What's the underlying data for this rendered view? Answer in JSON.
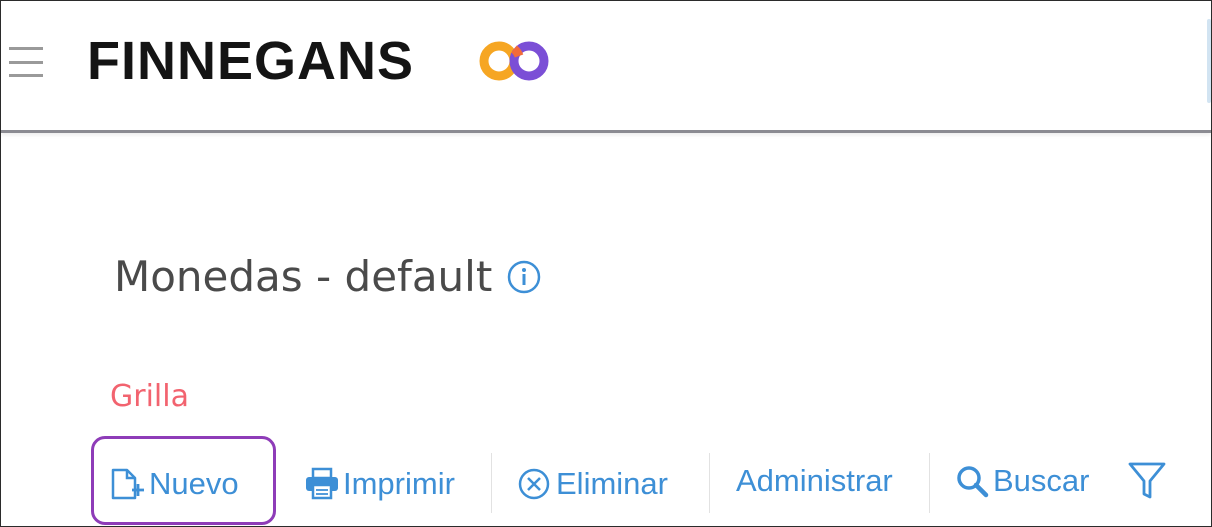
{
  "header": {
    "brand_name": "FINNEGANS",
    "menu_icon": "hamburger-menu-icon",
    "logo_icon": "infinity-logo-icon",
    "logo_colors": [
      "#f6a623",
      "#7b4fd6",
      "#f26b3a"
    ]
  },
  "page": {
    "title": "Monedas - default",
    "info_icon": "info-circle-icon",
    "section_label": "Grilla"
  },
  "toolbar": {
    "nuevo_label": "Nuevo",
    "nuevo_icon": "new-document-icon",
    "imprimir_label": "Imprimir",
    "imprimir_icon": "printer-icon",
    "eliminar_label": "Eliminar",
    "eliminar_icon": "close-circle-icon",
    "administrar_label": "Administrar",
    "buscar_label": "Buscar",
    "buscar_icon": "search-icon",
    "filter_icon": "filter-icon"
  },
  "colors": {
    "accent": "#3d8fd6",
    "section_label": "#f2636f",
    "highlight": "#8e3cb8",
    "title": "#4a4a4a"
  }
}
